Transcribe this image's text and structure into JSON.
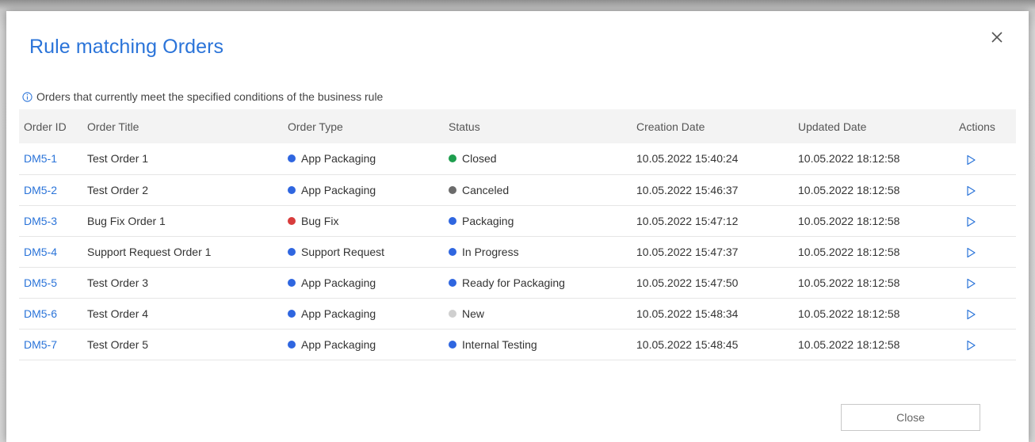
{
  "dialog": {
    "title": "Rule matching Orders",
    "info_text": "Orders that currently meet the specified conditions of the business rule",
    "close_button_label": "Close"
  },
  "table": {
    "columns": [
      "Order ID",
      "Order Title",
      "Order Type",
      "Status",
      "Creation Date",
      "Updated Date",
      "Actions"
    ],
    "rows": [
      {
        "id": "DM5-1",
        "title": "Test Order 1",
        "type": "App Packaging",
        "type_color": "#2f66e0",
        "status": "Closed",
        "status_color": "#1e9e4e",
        "created": "10.05.2022 15:40:24",
        "updated": "10.05.2022 18:12:58"
      },
      {
        "id": "DM5-2",
        "title": "Test Order 2",
        "type": "App Packaging",
        "type_color": "#2f66e0",
        "status": "Canceled",
        "status_color": "#6b6b6b",
        "created": "10.05.2022 15:46:37",
        "updated": "10.05.2022 18:12:58"
      },
      {
        "id": "DM5-3",
        "title": "Bug Fix Order 1",
        "type": "Bug Fix",
        "type_color": "#d83c3c",
        "status": "Packaging",
        "status_color": "#2f66e0",
        "created": "10.05.2022 15:47:12",
        "updated": "10.05.2022 18:12:58"
      },
      {
        "id": "DM5-4",
        "title": "Support Request Order 1",
        "type": "Support Request",
        "type_color": "#2f66e0",
        "status": "In Progress",
        "status_color": "#2f66e0",
        "created": "10.05.2022 15:47:37",
        "updated": "10.05.2022 18:12:58"
      },
      {
        "id": "DM5-5",
        "title": "Test Order 3",
        "type": "App Packaging",
        "type_color": "#2f66e0",
        "status": "Ready for Packaging",
        "status_color": "#2f66e0",
        "created": "10.05.2022 15:47:50",
        "updated": "10.05.2022 18:12:58"
      },
      {
        "id": "DM5-6",
        "title": "Test Order 4",
        "type": "App Packaging",
        "type_color": "#2f66e0",
        "status": "New",
        "status_color": "#cfcfcf",
        "created": "10.05.2022 15:48:34",
        "updated": "10.05.2022 18:12:58"
      },
      {
        "id": "DM5-7",
        "title": "Test Order 5",
        "type": "App Packaging",
        "type_color": "#2f66e0",
        "status": "Internal Testing",
        "status_color": "#2f66e0",
        "created": "10.05.2022 15:48:45",
        "updated": "10.05.2022 18:12:58"
      }
    ]
  },
  "icons": {
    "close": "close-icon",
    "info": "info-icon",
    "row_action": "play-icon"
  },
  "colors": {
    "accent": "#2b74d9",
    "header_bg": "#f3f3f3"
  }
}
